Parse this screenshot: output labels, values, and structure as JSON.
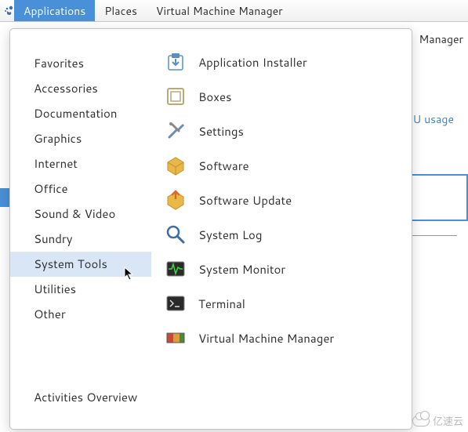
{
  "menubar": {
    "applications": "Applications",
    "places": "Places",
    "vmm": "Virtual Machine Manager"
  },
  "window": {
    "title_fragment": "Manager",
    "cpu_label": "U usage"
  },
  "categories": {
    "items": [
      "Favorites",
      "Accessories",
      "Documentation",
      "Graphics",
      "Internet",
      "Office",
      "Sound & Video",
      "Sundry",
      "System Tools",
      "Utilities",
      "Other"
    ],
    "selected_index": 8,
    "activities": "Activities Overview"
  },
  "apps": [
    {
      "id": "application-installer",
      "label": "Application Installer"
    },
    {
      "id": "boxes",
      "label": "Boxes"
    },
    {
      "id": "settings",
      "label": "Settings"
    },
    {
      "id": "software",
      "label": "Software"
    },
    {
      "id": "software-update",
      "label": "Software Update"
    },
    {
      "id": "system-log",
      "label": "System Log"
    },
    {
      "id": "system-monitor",
      "label": "System Monitor"
    },
    {
      "id": "terminal",
      "label": "Terminal"
    },
    {
      "id": "virtual-machine-manager",
      "label": "Virtual Machine Manager"
    }
  ],
  "watermark": "亿速云"
}
